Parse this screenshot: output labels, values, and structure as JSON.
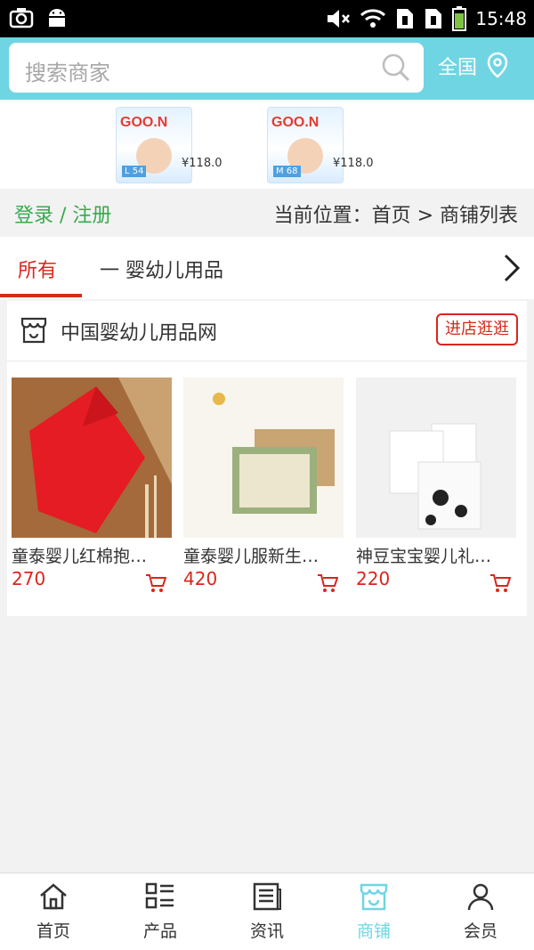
{
  "status_bar": {
    "time": "15:48",
    "icons": [
      "camera-icon",
      "android-icon",
      "mute-icon",
      "wifi-icon",
      "sim1-icon",
      "sim2-icon",
      "battery-icon"
    ]
  },
  "search": {
    "placeholder": "搜索商家",
    "region_label": "全国"
  },
  "banner": {
    "items": [
      {
        "brand": "GOO.N",
        "size": "L 54",
        "price": "¥118.0"
      },
      {
        "brand": "GOO.N",
        "size": "M 68",
        "price": "¥118.0"
      }
    ]
  },
  "nav_row": {
    "login_label": "登录 / 注册",
    "breadcrumb": "当前位置：首页 > 商铺列表"
  },
  "tabs": {
    "all_label": "所有",
    "category_label": "一 婴幼儿用品"
  },
  "store": {
    "name": "中国婴幼儿用品网",
    "enter_label": "进店逛逛",
    "products": [
      {
        "name": "童泰婴儿红棉抱…",
        "price": "270"
      },
      {
        "name": "童泰婴儿服新生…",
        "price": "420"
      },
      {
        "name": "神豆宝宝婴儿礼…",
        "price": "220"
      }
    ]
  },
  "bottom_nav": {
    "items": [
      {
        "label": "首页",
        "icon": "home-icon"
      },
      {
        "label": "产品",
        "icon": "products-icon"
      },
      {
        "label": "资讯",
        "icon": "news-icon"
      },
      {
        "label": "商铺",
        "icon": "shop-icon",
        "active": true
      },
      {
        "label": "会员",
        "icon": "member-icon"
      }
    ]
  },
  "colors": {
    "accent": "#6fd5e3",
    "red": "#d9261c",
    "green": "#3aa94f"
  }
}
